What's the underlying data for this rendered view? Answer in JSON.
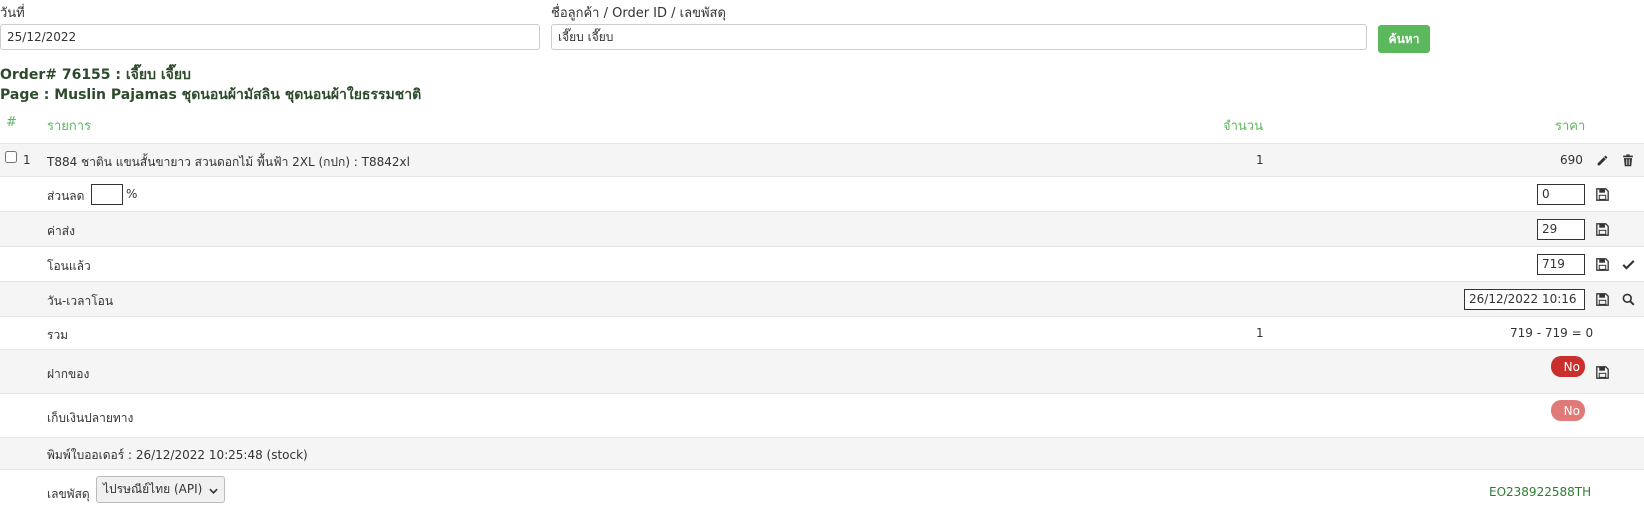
{
  "search": {
    "date_label": "วันที่",
    "date_value": "25/12/2022",
    "customer_label": "ชื่อลูกค้า / Order ID / เลขพัสดุ",
    "customer_value": "เจี๊ยบ เจี๊ยบ",
    "search_button": "ค้นหา"
  },
  "order": {
    "title": "Order# 76155 : เจี๊ยบ เจี๊ยบ",
    "page": "Page : Muslin Pajamas ชุดนอนผ้ามัสลิน ชุดนอนผ้าใยธรรมชาติ"
  },
  "table": {
    "headers": {
      "num": "#",
      "item": "รายการ",
      "qty": "จำนวน",
      "price": "ราคา"
    },
    "item": {
      "num": "1",
      "name": "T884 ชาติน แขนสั้นขายาว สวนดอกไม้ พื้นฟ้า 2XL (กปก) : T8842xl",
      "qty": "1",
      "price": "690"
    },
    "discount": {
      "label": "ส่วนลด",
      "percent_value": "",
      "percent_sign": "%",
      "value": "0"
    },
    "shipping": {
      "label": "ค่าส่ง",
      "value": "29"
    },
    "paid": {
      "label": "โอนแล้ว",
      "value": "719"
    },
    "transfer_time": {
      "label": "วัน-เวลาโอน",
      "value": "26/12/2022 10:16"
    },
    "total": {
      "label": "รวม",
      "qty": "1",
      "value": "719 - 719 = 0"
    },
    "deposit": {
      "label": "ฝากของ",
      "toggle": "No"
    },
    "cod": {
      "label": "เก็บเงินปลายทาง",
      "toggle": "No"
    },
    "printed": {
      "label": "พิมพ์ใบออเดอร์ : 26/12/2022 10:25:48 (stock)"
    },
    "tracking": {
      "label": "เลขพัสดุ",
      "carrier": "ไปรษณีย์ไทย (API)",
      "number": "EO238922588TH"
    }
  },
  "colors": {
    "accent_green": "#5cb85c",
    "toggle_red": "#c9302c",
    "toggle_light_red": "#e07a78",
    "tracking_green": "#2e7d32"
  }
}
